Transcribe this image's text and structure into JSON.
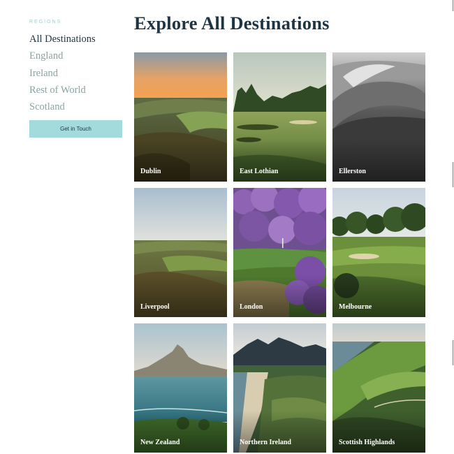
{
  "sidebar": {
    "regions_label": "REGIONS",
    "items": [
      {
        "label": "All Destinations",
        "active": true
      },
      {
        "label": "England",
        "active": false
      },
      {
        "label": "Ireland",
        "active": false
      },
      {
        "label": "Rest of World",
        "active": false
      },
      {
        "label": "Scotland",
        "active": false
      }
    ],
    "cta_label": "Get in Touch"
  },
  "main": {
    "title": "Explore All Destinations",
    "destinations": [
      {
        "name": "Dublin"
      },
      {
        "name": "East Lothian"
      },
      {
        "name": "Ellerston"
      },
      {
        "name": "Liverpool"
      },
      {
        "name": "London"
      },
      {
        "name": "Melbourne"
      },
      {
        "name": "New Zealand"
      },
      {
        "name": "Northern Ireland"
      },
      {
        "name": "Scottish Highlands"
      }
    ]
  },
  "colors": {
    "heading": "#1f3442",
    "nav_inactive": "#8ca3a3",
    "accent": "#a3dadc",
    "regions_label": "#9fcfcf"
  }
}
